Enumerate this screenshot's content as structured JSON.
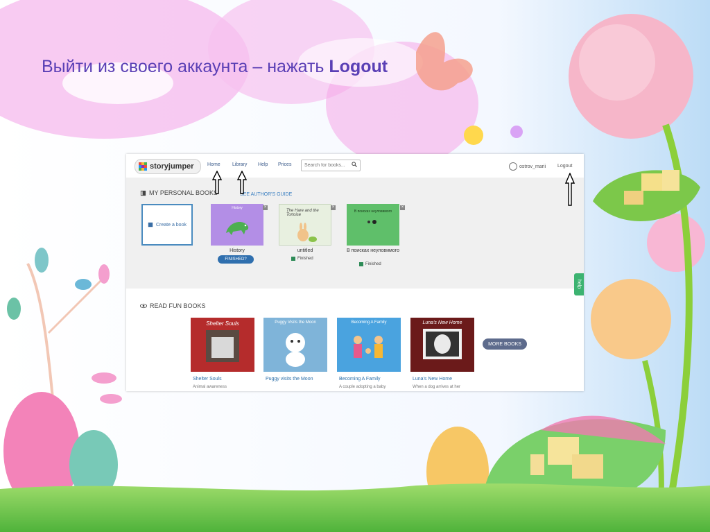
{
  "slide": {
    "title_text": "Выйти из своего аккаунта – нажать ",
    "title_bold": "Logout"
  },
  "app": {
    "logo_text": "storyjumper",
    "nav": [
      "Home",
      "Library",
      "Help",
      "Prices"
    ],
    "search_placeholder": "Search for books...",
    "username": "ostrov_marii",
    "logout_label": "Logout"
  },
  "personal_section": {
    "title": "MY PERSONAL BOOKS",
    "guide_link": "SEE AUTHOR'S GUIDE",
    "create_label": "Create a book",
    "books": [
      {
        "title": "History",
        "cover_text": "History",
        "status": "FINISHED?",
        "color": "#b38ee6"
      },
      {
        "title": "untitled",
        "cover_text": "The Hare and the Tortoise",
        "status": "Finished",
        "color": "#e8f0e0"
      },
      {
        "title": "В поисках неуловимого",
        "cover_text": "В поисках неуловимого",
        "status": "Finished",
        "color": "#5fbf6a"
      }
    ]
  },
  "fun_section": {
    "title": "READ FUN BOOKS",
    "more_label": "MORE BOOKS",
    "books": [
      {
        "title": "Shelter Souls",
        "cover_text": "Shelter Souls",
        "desc": "Animal awareness",
        "color": "#b52c2c"
      },
      {
        "title": "Puggy visits the Moon",
        "cover_text": "Puggy Visits the Moon",
        "desc": "",
        "color": "#7fb4d9"
      },
      {
        "title": "Becoming A Family",
        "cover_text": "Becoming A Family",
        "desc": "A couple adopting a baby",
        "color": "#4aa3df"
      },
      {
        "title": "Luna's New Home",
        "cover_text": "Luna's New Home",
        "desc": "When a dog arrives at her",
        "color": "#6b1a1a"
      }
    ]
  },
  "help_tab": "help",
  "colors": {
    "title": "#5a3fb5",
    "accent": "#2f6fae",
    "link": "#3a7fc1"
  }
}
